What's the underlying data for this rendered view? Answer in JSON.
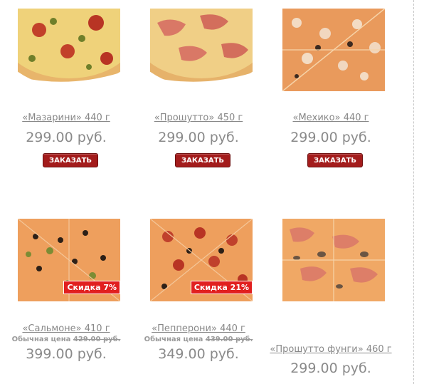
{
  "products": [
    {
      "name": "«Мазарини» 440 г",
      "price": "299.00 руб.",
      "order_label": "ЗАКАЗАТЬ",
      "image": "pizza-mazarini"
    },
    {
      "name": "«Прошутто» 450 г",
      "price": "299.00 руб.",
      "order_label": "ЗАКАЗАТЬ",
      "image": "pizza-prosciutto"
    },
    {
      "name": "«Мехико» 440 г",
      "price": "299.00 руб.",
      "order_label": "ЗАКАЗАТЬ",
      "image": "pizza-mexico"
    },
    {
      "name": "«Сальмоне» 410 г",
      "old_price_label": "Обычная цена",
      "old_price": "429.00 руб.",
      "price": "399.00 руб.",
      "discount": "Скидка 7%",
      "image": "pizza-salmone"
    },
    {
      "name": "«Пепперони» 440 г",
      "old_price_label": "Обычная цена",
      "old_price": "439.00 руб.",
      "price": "349.00 руб.",
      "discount": "Скидка 21%",
      "image": "pizza-pepperoni"
    },
    {
      "name": "«Прошутто фунги» 460 г",
      "price": "299.00 руб.",
      "image": "pizza-prosciutto-funghi"
    }
  ],
  "colors": {
    "button": "#a31c1c",
    "badge": "#e11f1f",
    "text": "#888888"
  }
}
